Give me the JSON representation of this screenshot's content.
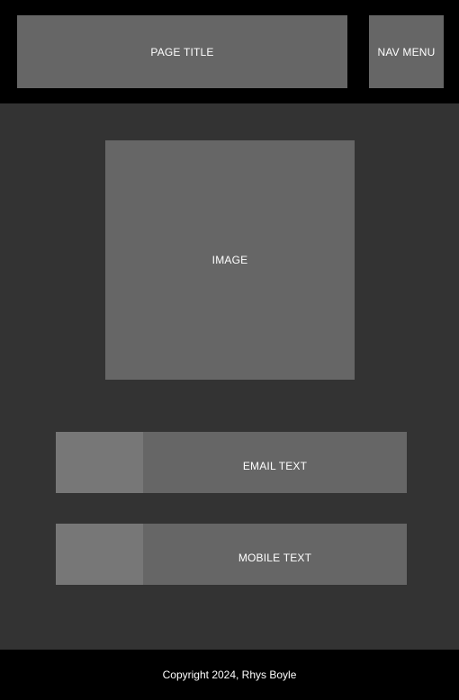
{
  "header": {
    "title": "PAGE TITLE",
    "nav_label": "NAV MENU"
  },
  "main": {
    "image_label": "IMAGE",
    "contact_rows": [
      {
        "label": "EMAIL TEXT"
      },
      {
        "label": "MOBILE TEXT"
      }
    ]
  },
  "footer": {
    "copyright": "Copyright 2024, Rhys Boyle"
  },
  "colors": {
    "header_bg": "#000000",
    "page_bg": "#333333",
    "block_bg": "#666666",
    "icon_box_bg": "#777777",
    "text": "#ffffff"
  }
}
